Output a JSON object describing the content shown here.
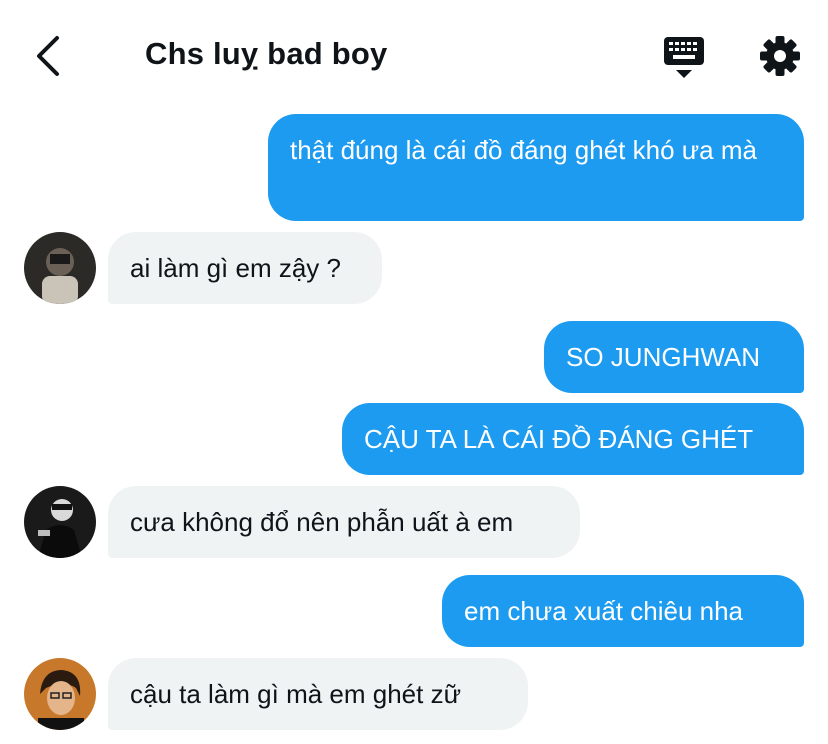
{
  "header": {
    "title": "Chs luỵ bad boy",
    "back_icon": "chevron-left-icon",
    "keyboard_icon": "keyboard-icon",
    "settings_icon": "gear-icon"
  },
  "colors": {
    "outgoing_bubble": "#1d9bf0",
    "incoming_bubble": "#eff3f4",
    "text_dark": "#0f1419"
  },
  "messages": [
    {
      "direction": "outgoing",
      "text": "thật đúng là cái đồ đáng ghét khó ưa mà"
    },
    {
      "direction": "incoming",
      "text": "ai làm gì em zậy ?"
    },
    {
      "direction": "outgoing",
      "text": "SO JUNGHWAN"
    },
    {
      "direction": "outgoing",
      "text": "CẬU TA LÀ CÁI ĐỒ ĐÁNG GHÉT"
    },
    {
      "direction": "incoming",
      "text": "cưa không đổ nên phẫn uất à em"
    },
    {
      "direction": "outgoing",
      "text": "em chưa xuất chiêu nha"
    },
    {
      "direction": "incoming",
      "text": "cậu ta làm gì mà em ghét zữ"
    }
  ]
}
